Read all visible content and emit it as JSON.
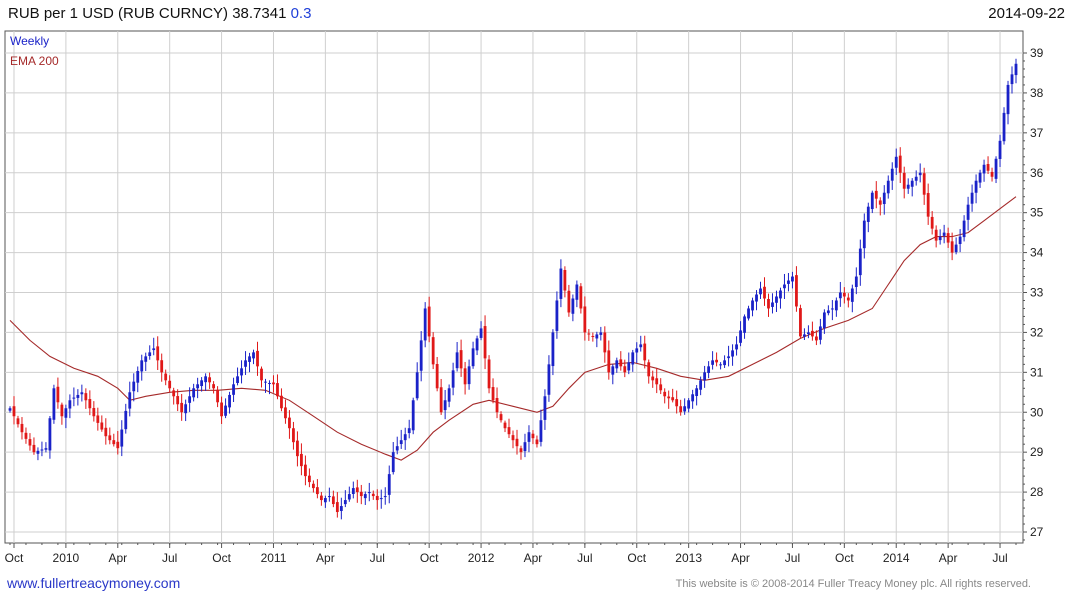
{
  "header": {
    "title": "RUB per 1 USD (RUB CURNCY) 38.7341",
    "change": "0.3",
    "date": "2014-09-22"
  },
  "footer": {
    "link": "www.fullertreacymoney.com",
    "copyright": "This website is © 2008-2014 Fuller Treacy Money plc. All rights reserved."
  },
  "colors": {
    "up": "#1a22c8",
    "down": "#e01818",
    "ema": "#a52a2a",
    "grid": "#cfcfcf",
    "frame": "#555555"
  },
  "chart_data": {
    "type": "candlestick",
    "frequency_label": "Weekly",
    "ema_label": "EMA 200",
    "ylim": [
      27,
      39
    ],
    "y_ticks": [
      27,
      28,
      29,
      30,
      31,
      32,
      33,
      34,
      35,
      36,
      37,
      38,
      39
    ],
    "x_ticks": [
      {
        "label": "Oct",
        "week": 1
      },
      {
        "label": "2010",
        "week": 14
      },
      {
        "label": "Apr",
        "week": 27
      },
      {
        "label": "Jul",
        "week": 40
      },
      {
        "label": "Oct",
        "week": 53
      },
      {
        "label": "2011",
        "week": 66
      },
      {
        "label": "Apr",
        "week": 79
      },
      {
        "label": "Jul",
        "week": 92
      },
      {
        "label": "Oct",
        "week": 105
      },
      {
        "label": "2012",
        "week": 118
      },
      {
        "label": "Apr",
        "week": 131
      },
      {
        "label": "Jul",
        "week": 144
      },
      {
        "label": "Oct",
        "week": 157
      },
      {
        "label": "2013",
        "week": 170
      },
      {
        "label": "Apr",
        "week": 183
      },
      {
        "label": "Jul",
        "week": 196
      },
      {
        "label": "Oct",
        "week": 209
      },
      {
        "label": "2014",
        "week": 222
      },
      {
        "label": "Apr",
        "week": 235
      },
      {
        "label": "Jul",
        "week": 248
      }
    ],
    "close_path": [
      [
        0,
        30.1
      ],
      [
        3,
        29.5
      ],
      [
        6,
        29.0
      ],
      [
        9,
        29.1
      ],
      [
        11,
        30.6
      ],
      [
        13,
        29.9
      ],
      [
        15,
        30.3
      ],
      [
        18,
        30.5
      ],
      [
        21,
        29.9
      ],
      [
        24,
        29.4
      ],
      [
        27,
        29.1
      ],
      [
        30,
        30.5
      ],
      [
        33,
        31.3
      ],
      [
        36,
        31.6
      ],
      [
        38,
        31.0
      ],
      [
        41,
        30.4
      ],
      [
        43,
        30.0
      ],
      [
        46,
        30.6
      ],
      [
        49,
        30.9
      ],
      [
        51,
        30.6
      ],
      [
        53,
        29.9
      ],
      [
        56,
        30.7
      ],
      [
        59,
        31.3
      ],
      [
        61,
        31.5
      ],
      [
        63,
        30.8
      ],
      [
        66,
        30.7
      ],
      [
        68,
        30.1
      ],
      [
        70,
        29.6
      ],
      [
        72,
        28.9
      ],
      [
        74,
        28.4
      ],
      [
        76,
        28.1
      ],
      [
        78,
        27.8
      ],
      [
        80,
        27.9
      ],
      [
        82,
        27.5
      ],
      [
        84,
        27.8
      ],
      [
        86,
        28.1
      ],
      [
        88,
        27.9
      ],
      [
        90,
        28.0
      ],
      [
        92,
        27.8
      ],
      [
        94,
        27.9
      ],
      [
        96,
        29.0
      ],
      [
        98,
        29.3
      ],
      [
        100,
        29.6
      ],
      [
        102,
        31.0
      ],
      [
        104,
        32.6
      ],
      [
        106,
        31.2
      ],
      [
        108,
        30.0
      ],
      [
        110,
        30.6
      ],
      [
        112,
        31.5
      ],
      [
        114,
        30.7
      ],
      [
        116,
        31.6
      ],
      [
        118,
        32.1
      ],
      [
        120,
        30.6
      ],
      [
        122,
        30.0
      ],
      [
        124,
        29.6
      ],
      [
        126,
        29.3
      ],
      [
        128,
        29.0
      ],
      [
        130,
        29.5
      ],
      [
        132,
        29.2
      ],
      [
        134,
        30.4
      ],
      [
        136,
        32.0
      ],
      [
        138,
        33.6
      ],
      [
        140,
        32.5
      ],
      [
        142,
        33.2
      ],
      [
        144,
        32.0
      ],
      [
        146,
        31.9
      ],
      [
        148,
        32.0
      ],
      [
        150,
        31.0
      ],
      [
        152,
        31.3
      ],
      [
        154,
        31.0
      ],
      [
        156,
        31.5
      ],
      [
        158,
        31.7
      ],
      [
        160,
        30.9
      ],
      [
        162,
        30.7
      ],
      [
        164,
        30.4
      ],
      [
        166,
        30.3
      ],
      [
        168,
        30.0
      ],
      [
        170,
        30.3
      ],
      [
        172,
        30.6
      ],
      [
        174,
        31.0
      ],
      [
        176,
        31.3
      ],
      [
        178,
        31.2
      ],
      [
        180,
        31.4
      ],
      [
        182,
        31.7
      ],
      [
        184,
        32.4
      ],
      [
        186,
        32.8
      ],
      [
        188,
        33.1
      ],
      [
        190,
        32.6
      ],
      [
        192,
        32.9
      ],
      [
        194,
        33.2
      ],
      [
        196,
        33.4
      ],
      [
        198,
        31.9
      ],
      [
        200,
        32.0
      ],
      [
        202,
        31.8
      ],
      [
        204,
        32.5
      ],
      [
        206,
        32.6
      ],
      [
        208,
        33.0
      ],
      [
        210,
        32.8
      ],
      [
        212,
        33.4
      ],
      [
        214,
        34.8
      ],
      [
        216,
        35.5
      ],
      [
        218,
        35.2
      ],
      [
        220,
        35.8
      ],
      [
        222,
        36.4
      ],
      [
        224,
        35.6
      ],
      [
        226,
        35.8
      ],
      [
        228,
        36.0
      ],
      [
        230,
        34.9
      ],
      [
        232,
        34.3
      ],
      [
        234,
        34.5
      ],
      [
        236,
        34.0
      ],
      [
        238,
        34.4
      ],
      [
        240,
        35.2
      ],
      [
        242,
        35.8
      ],
      [
        244,
        36.2
      ],
      [
        246,
        35.9
      ],
      [
        248,
        36.8
      ],
      [
        250,
        38.2
      ],
      [
        252,
        38.73
      ]
    ],
    "ema_path": [
      [
        0,
        32.3
      ],
      [
        5,
        31.8
      ],
      [
        10,
        31.4
      ],
      [
        16,
        31.1
      ],
      [
        22,
        30.9
      ],
      [
        27,
        30.6
      ],
      [
        30,
        30.3
      ],
      [
        34,
        30.4
      ],
      [
        40,
        30.5
      ],
      [
        46,
        30.55
      ],
      [
        52,
        30.55
      ],
      [
        58,
        30.6
      ],
      [
        64,
        30.55
      ],
      [
        70,
        30.3
      ],
      [
        76,
        29.9
      ],
      [
        82,
        29.5
      ],
      [
        88,
        29.2
      ],
      [
        94,
        28.95
      ],
      [
        98,
        28.8
      ],
      [
        102,
        29.05
      ],
      [
        106,
        29.5
      ],
      [
        110,
        29.8
      ],
      [
        116,
        30.2
      ],
      [
        120,
        30.3
      ],
      [
        126,
        30.15
      ],
      [
        132,
        30.0
      ],
      [
        136,
        30.15
      ],
      [
        140,
        30.6
      ],
      [
        144,
        31.0
      ],
      [
        150,
        31.2
      ],
      [
        156,
        31.25
      ],
      [
        162,
        31.1
      ],
      [
        168,
        30.9
      ],
      [
        174,
        30.8
      ],
      [
        180,
        30.9
      ],
      [
        186,
        31.2
      ],
      [
        192,
        31.5
      ],
      [
        198,
        31.85
      ],
      [
        204,
        32.1
      ],
      [
        210,
        32.3
      ],
      [
        216,
        32.6
      ],
      [
        220,
        33.2
      ],
      [
        224,
        33.8
      ],
      [
        228,
        34.2
      ],
      [
        232,
        34.4
      ],
      [
        236,
        34.4
      ],
      [
        240,
        34.5
      ],
      [
        244,
        34.8
      ],
      [
        248,
        35.1
      ],
      [
        252,
        35.4
      ]
    ]
  }
}
